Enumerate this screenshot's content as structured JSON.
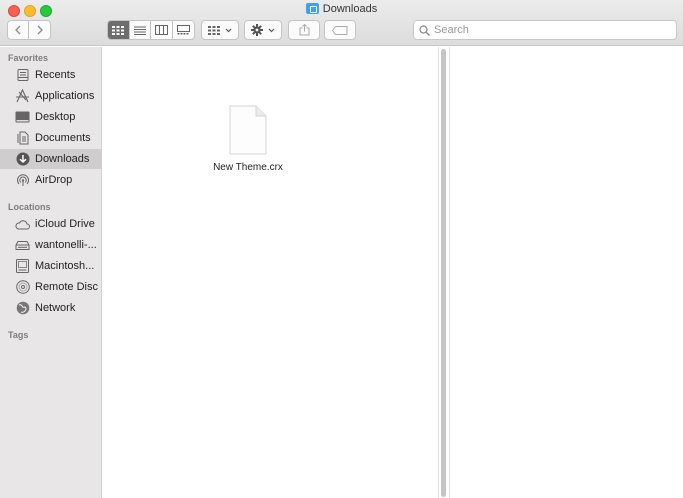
{
  "window": {
    "title": "Downloads"
  },
  "toolbar": {
    "back_icon": "chevron-left-icon",
    "forward_icon": "chevron-right-icon",
    "views": [
      "icon-view",
      "list-view",
      "column-view",
      "gallery-view"
    ],
    "active_view": "icon-view",
    "group_icon": "group-by-icon",
    "action_icon": "gear-icon",
    "share_icon": "share-icon",
    "tag_icon": "tag-icon"
  },
  "search": {
    "placeholder": "Search"
  },
  "sidebar": {
    "favorites_title": "Favorites",
    "favorites": [
      {
        "label": "Recents",
        "icon": "recents-icon"
      },
      {
        "label": "Applications",
        "icon": "applications-icon"
      },
      {
        "label": "Desktop",
        "icon": "desktop-icon"
      },
      {
        "label": "Documents",
        "icon": "documents-icon"
      },
      {
        "label": "Downloads",
        "icon": "downloads-icon",
        "selected": true
      },
      {
        "label": "AirDrop",
        "icon": "airdrop-icon"
      }
    ],
    "locations_title": "Locations",
    "locations": [
      {
        "label": "iCloud Drive",
        "icon": "icloud-icon"
      },
      {
        "label": "wantonelli-...",
        "icon": "network-drive-icon"
      },
      {
        "label": "Macintosh...",
        "icon": "hard-disk-icon"
      },
      {
        "label": "Remote Disc",
        "icon": "disc-icon"
      },
      {
        "label": "Network",
        "icon": "network-globe-icon"
      }
    ],
    "tags_title": "Tags"
  },
  "files": [
    {
      "name": "New Theme.crx",
      "icon": "document-file-icon"
    }
  ],
  "colors": {
    "sidebar_bg": "#e8e6e6",
    "selected_bg": "#cfcdcd",
    "folder_blue": "#3fa1f5",
    "close": "#fd5f57",
    "minimize": "#febc2e",
    "zoom": "#28c840"
  }
}
